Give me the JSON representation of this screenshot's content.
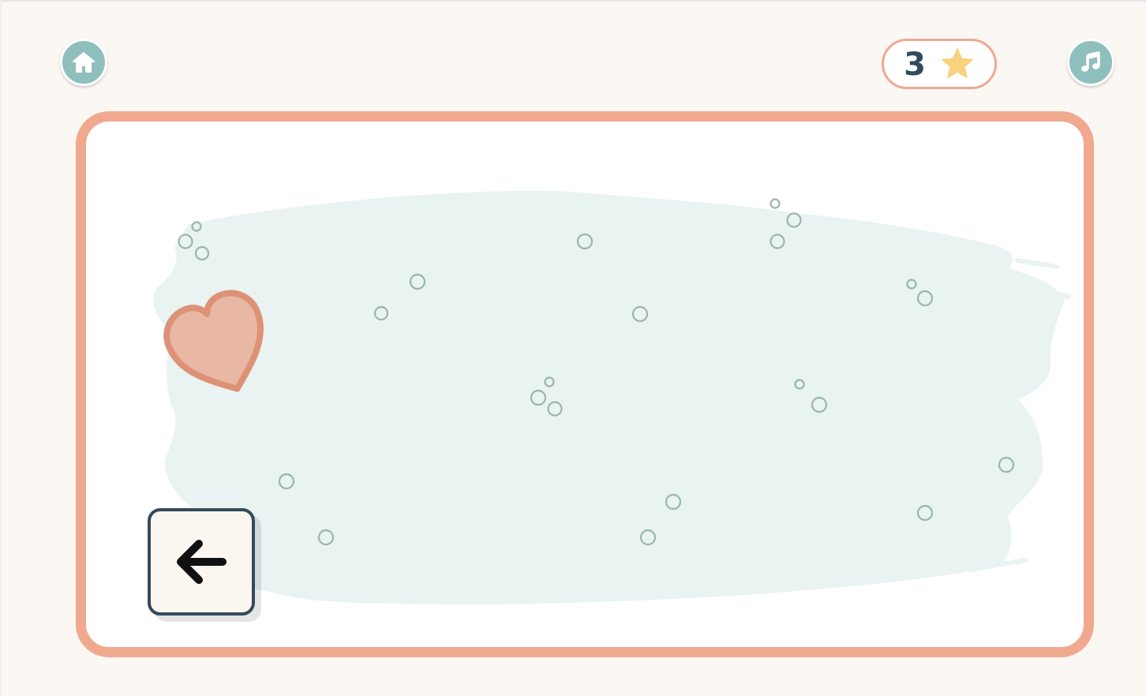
{
  "header": {
    "home_button": {
      "icon": "home-icon"
    },
    "score": {
      "value": "3",
      "icon": "star-icon"
    },
    "music_button": {
      "icon": "music-note-icon"
    }
  },
  "board": {
    "item": {
      "icon": "heart-icon"
    },
    "back_button": {
      "icon": "arrow-left-icon"
    }
  },
  "colors": {
    "background": "#fbf7f2",
    "accent_teal": "#8fbfbc",
    "board_border": "#f0a98f",
    "brush_area": "#e9f3f1",
    "heart_fill": "#e8b8a5",
    "heart_stroke": "#dd9277",
    "star": "#f8d27c",
    "dark_text": "#2f4a5c"
  }
}
